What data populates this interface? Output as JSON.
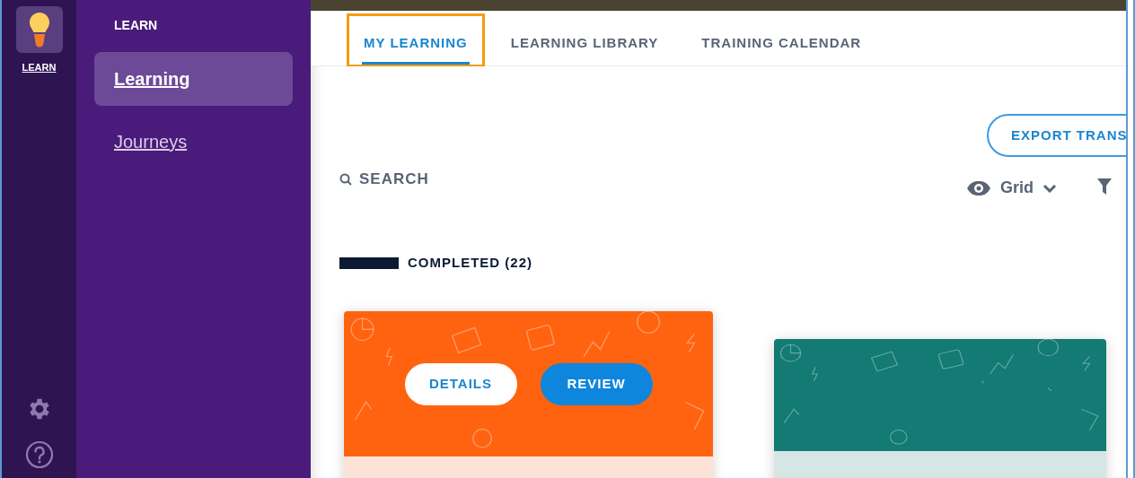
{
  "rail": {
    "app_label": "LEARN"
  },
  "sidebar": {
    "heading": "LEARN",
    "items": [
      {
        "label": "Learning",
        "selected": true
      },
      {
        "label": "Journeys",
        "selected": false
      }
    ]
  },
  "tabs": [
    {
      "label": "MY LEARNING",
      "selected": true,
      "highlighted": true
    },
    {
      "label": "LEARNING LIBRARY",
      "selected": false,
      "highlighted": false
    },
    {
      "label": "TRAINING CALENDAR",
      "selected": false,
      "highlighted": false
    }
  ],
  "export_button": "EXPORT TRANS",
  "search": {
    "placeholder": "SEARCH"
  },
  "view_select": "Grid",
  "section": {
    "title": "COMPLETED (22)"
  },
  "cards": [
    {
      "color": "#ff6310",
      "buttons": [
        {
          "label": "DETAILS",
          "kind": "secondary"
        },
        {
          "label": "REVIEW",
          "kind": "primary"
        }
      ]
    },
    {
      "color": "#137a74"
    }
  ]
}
